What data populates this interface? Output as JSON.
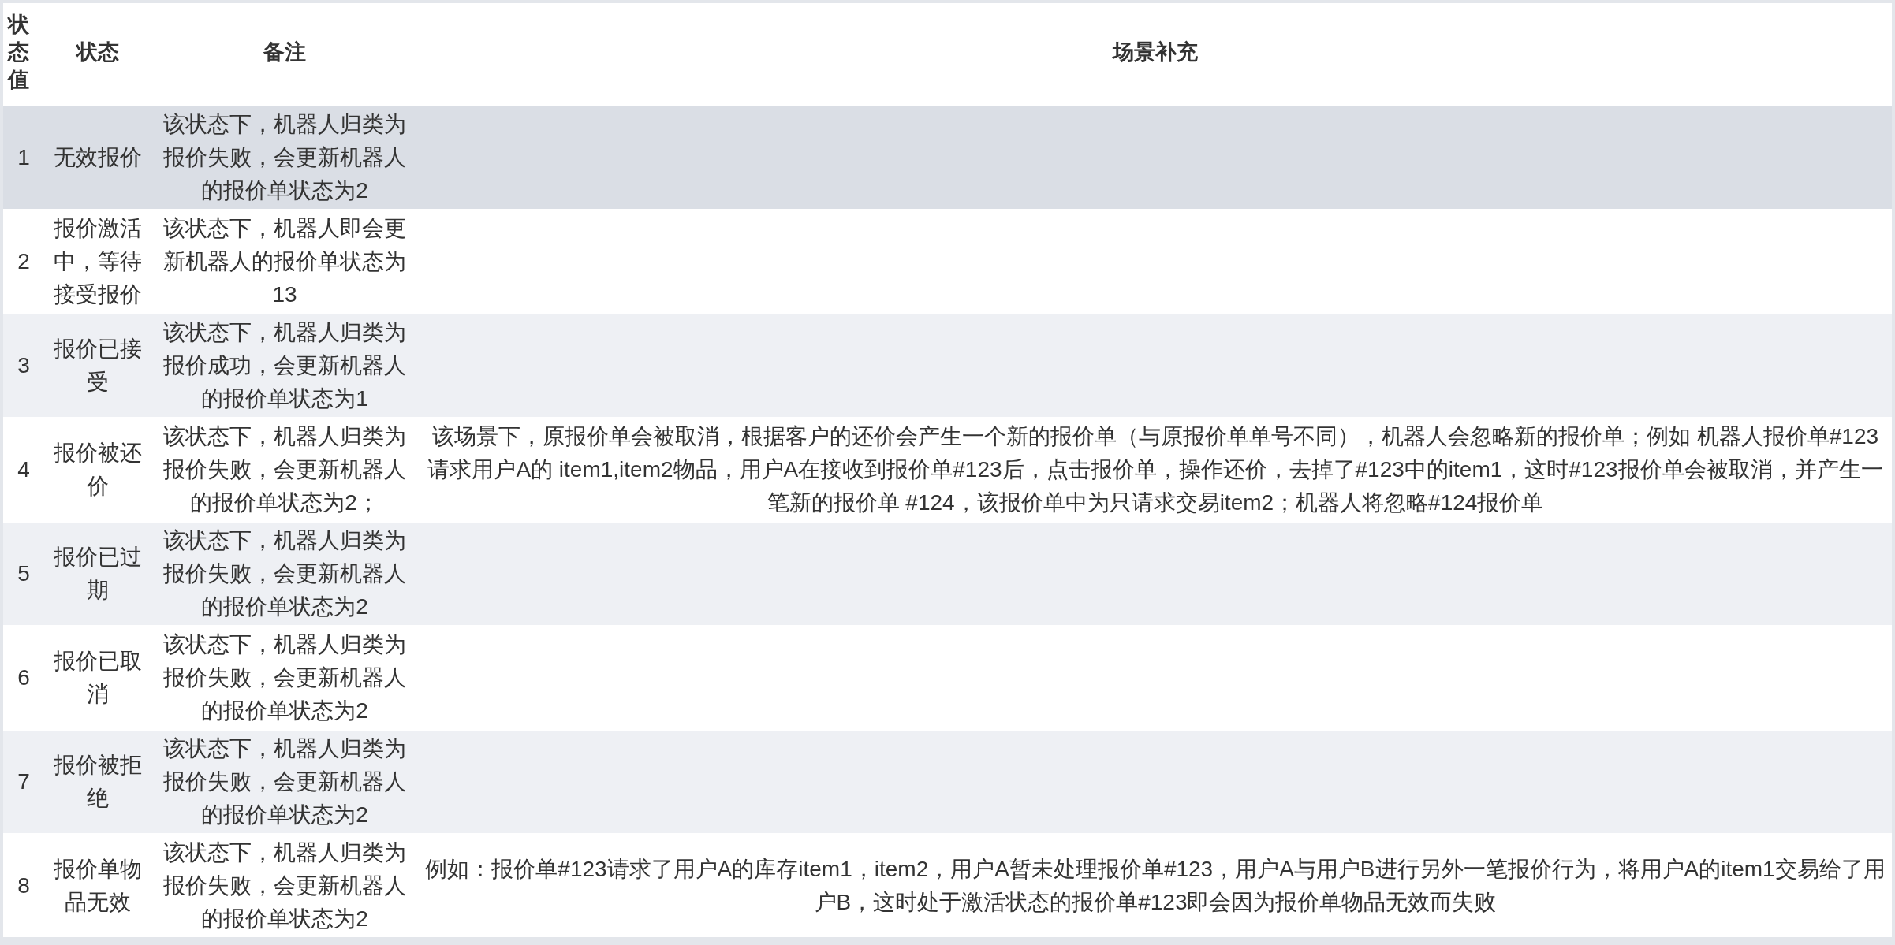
{
  "table": {
    "columns": [
      {
        "label": "状态值"
      },
      {
        "label": "状态"
      },
      {
        "label": "备注"
      },
      {
        "label": "场景补充"
      }
    ],
    "rows": [
      {
        "value": "1",
        "status": "无效报价",
        "note": "该状态下，机器人归类为报价失败，会更新机器人的报价单状态为2",
        "highlighted": true
      },
      {
        "value": "2",
        "status": "报价激活中，等待接受报价",
        "note": "该状态下，机器人即会更新机器人的报价单状态为13",
        "highlighted": false
      },
      {
        "value": "3",
        "status": "报价已接受",
        "note": "该状态下，机器人归类为报价成功，会更新机器人的报价单状态为1",
        "highlighted": false
      },
      {
        "value": "4",
        "status": "报价被还价",
        "note": "该状态下，机器人归类为报价失败，会更新机器人的报价单状态为2；",
        "scene": "该场景下，原报价单会被取消，根据客户的还价会产生一个新的报价单（与原报价单单号不同），机器人会忽略新的报价单；例如 机器人报价单#123请求用户A的 item1,item2物品，用户A在接收到报价单#123后，点击报价单，操作还价，去掉了#123中的item1，这时#123报价单会被取消，并产生一笔新的报价单 #124，该报价单中为只请求交易item2；机器人将忽略#124报价单",
        "highlighted": false
      },
      {
        "value": "5",
        "status": "报价已过期",
        "note": "该状态下，机器人归类为报价失败，会更新机器人的报价单状态为2",
        "highlighted": false
      },
      {
        "value": "6",
        "status": "报价已取消",
        "note": "该状态下，机器人归类为报价失败，会更新机器人的报价单状态为2",
        "highlighted": false
      },
      {
        "value": "7",
        "status": "报价被拒绝",
        "note": "该状态下，机器人归类为报价失败，会更新机器人的报价单状态为2",
        "highlighted": false
      },
      {
        "value": "8",
        "status": "报价单物品无效",
        "note": "该状态下，机器人归类为报价失败，会更新机器人的报价单状态为2",
        "scene": "例如：报价单#123请求了用户A的库存item1，item2，用户A暂未处理报价单#123，用户A与用户B进行另外一笔报价行为，将用户A的item1交易给了用户B，这时处于激活状态的报价单#123即会因为报价单物品无效而失败",
        "highlighted": false
      }
    ]
  }
}
